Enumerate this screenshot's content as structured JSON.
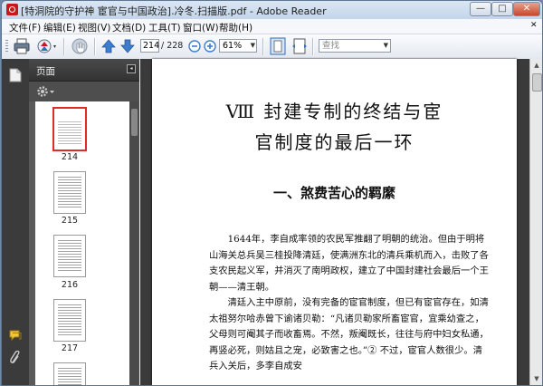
{
  "window": {
    "title": "[特洞院的守护神 宦官与中国政治].冷冬.扫描版.pdf - Adobe Reader",
    "minimize_glyph": "—",
    "maximize_glyph": "□",
    "close_glyph": "✕"
  },
  "menu": {
    "items": [
      "文件(F)",
      "编辑(E)",
      "视图(V)",
      "文档(D)",
      "工具(T)",
      "窗口(W)",
      "帮助(H)"
    ],
    "close_glyph": "✕"
  },
  "toolbar": {
    "page_current": "214",
    "page_total": "/ 228",
    "zoom": "61%",
    "search_placeholder": "查找"
  },
  "panel": {
    "title": "页面",
    "close_glyph": "◂",
    "thumbnails": [
      {
        "label": "214",
        "selected": true
      },
      {
        "label": "215",
        "selected": false
      },
      {
        "label": "216",
        "selected": false
      },
      {
        "label": "217",
        "selected": false
      }
    ]
  },
  "document": {
    "chapter_title_line1": "Ⅷ 封建专制的终结与宦",
    "chapter_title_line2": "官制度的最后一环",
    "section_title": "一、煞费苦心的羁縻",
    "paragraph1": "1644年，李自成率领的农民军推翻了明朝的统治。但由于明将山海关总兵吴三桂投降清廷，使满洲东北的清兵乘机而入，击败了各支农民起义军，并消灭了南明政权，建立了中国封建社会最后一个王朝——清王朝。",
    "paragraph2": "清廷入主中原前，没有完备的宦官制度，但已有宦官存在，如清太祖努尔哈赤曾下谕诸贝勒：“凡诸贝勒家所畜宦官，宜乘幼查之，父母则可阉其子而收畜焉。不然，叛阉既长，往往与府中妇女私通，再竖必死，则姑且之宠，必致害之也。”② 不过，宦官人数很少。清兵入关后，多李自成安"
  },
  "colors": {
    "selected_thumb_border": "#e12b2b",
    "navstrip": "#3b3b3b",
    "panel": "#5a5a5a",
    "doc_background": "#3a3a3a"
  }
}
